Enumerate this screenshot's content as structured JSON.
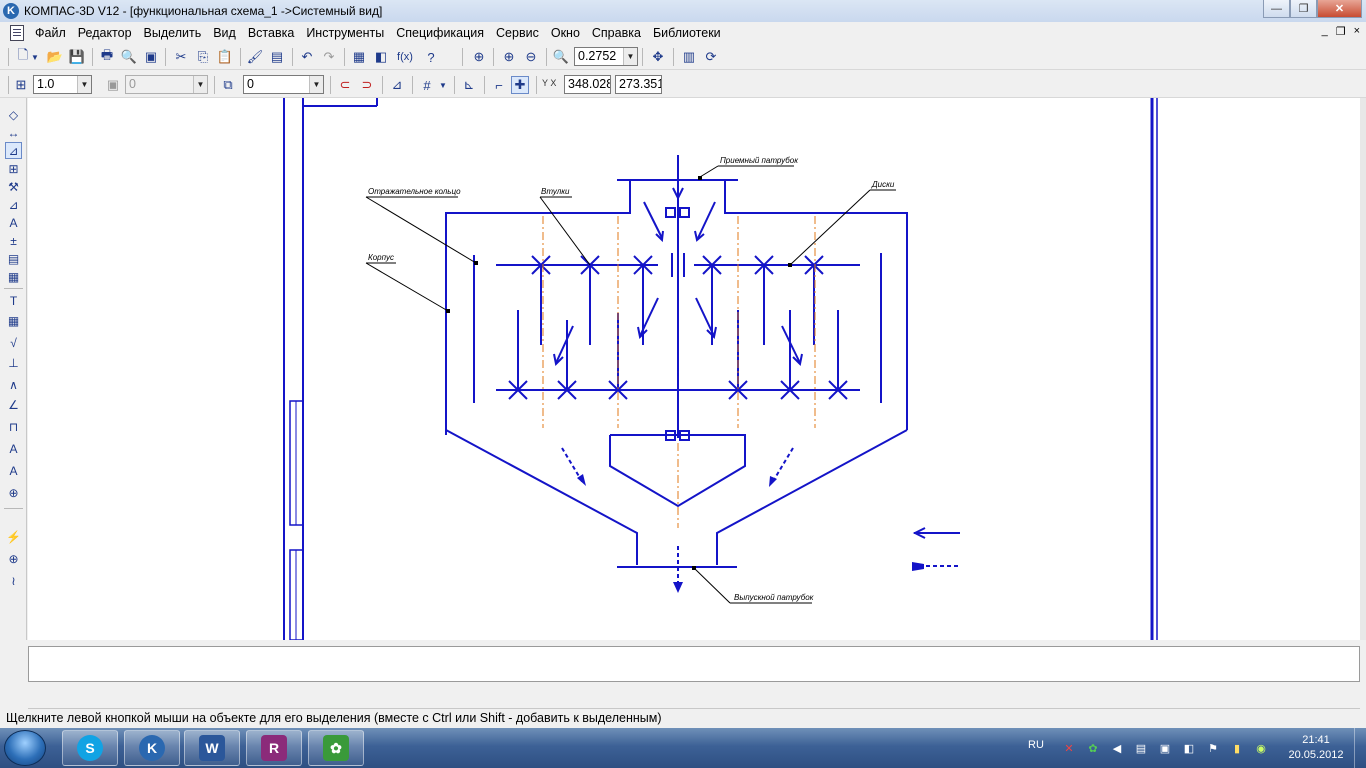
{
  "window": {
    "app_letter": "K",
    "title": "КОМПАС-3D V12 - [функциональная схема_1 ->Системный вид]",
    "btn_minimize": "—",
    "btn_maximize": "❐",
    "btn_close": "✕"
  },
  "menu": {
    "items": [
      "Файл",
      "Редактор",
      "Выделить",
      "Вид",
      "Вставка",
      "Инструменты",
      "Спецификация",
      "Сервис",
      "Окно",
      "Справка",
      "Библиотеки"
    ],
    "mdi_minimize": "_",
    "mdi_restore": "❐",
    "mdi_close": "×"
  },
  "toolbar_standard": {
    "zoom_value": "0.2752",
    "fx_label": "f(x)"
  },
  "toolbar_current": {
    "step_value": "1.0",
    "layer_value": "0",
    "style_value": "0",
    "x_value": "348.028",
    "y_value": "273.351",
    "xy_label": "Y X"
  },
  "drawing": {
    "labels": {
      "inlet": "Приемный патрубок",
      "reflective_ring": "Отражательное кольцо",
      "bushings": "Втулки",
      "disks": "Диски",
      "housing": "Корпус",
      "outlet": "Выпускной патрубок"
    },
    "line_color": "#1414c8",
    "axis_color": "#e07a1a"
  },
  "status": {
    "hint": "Щелкните левой кнопкой мыши на объекте для его выделения (вместе с Ctrl или Shift - добавить к выделенным)"
  },
  "taskbar": {
    "apps": [
      {
        "name": "skype",
        "letter": "S",
        "color": "#11a3e4"
      },
      {
        "name": "kompas",
        "letter": "K",
        "color": "#2a68b0"
      },
      {
        "name": "word",
        "letter": "W",
        "color": "#2b579a"
      },
      {
        "name": "winrar",
        "letter": "R",
        "color": "#8b2b7a"
      },
      {
        "name": "flower",
        "letter": "✿",
        "color": "#3a9a3a"
      }
    ],
    "lang": "RU",
    "time": "21:41",
    "date": "20.05.2012"
  }
}
